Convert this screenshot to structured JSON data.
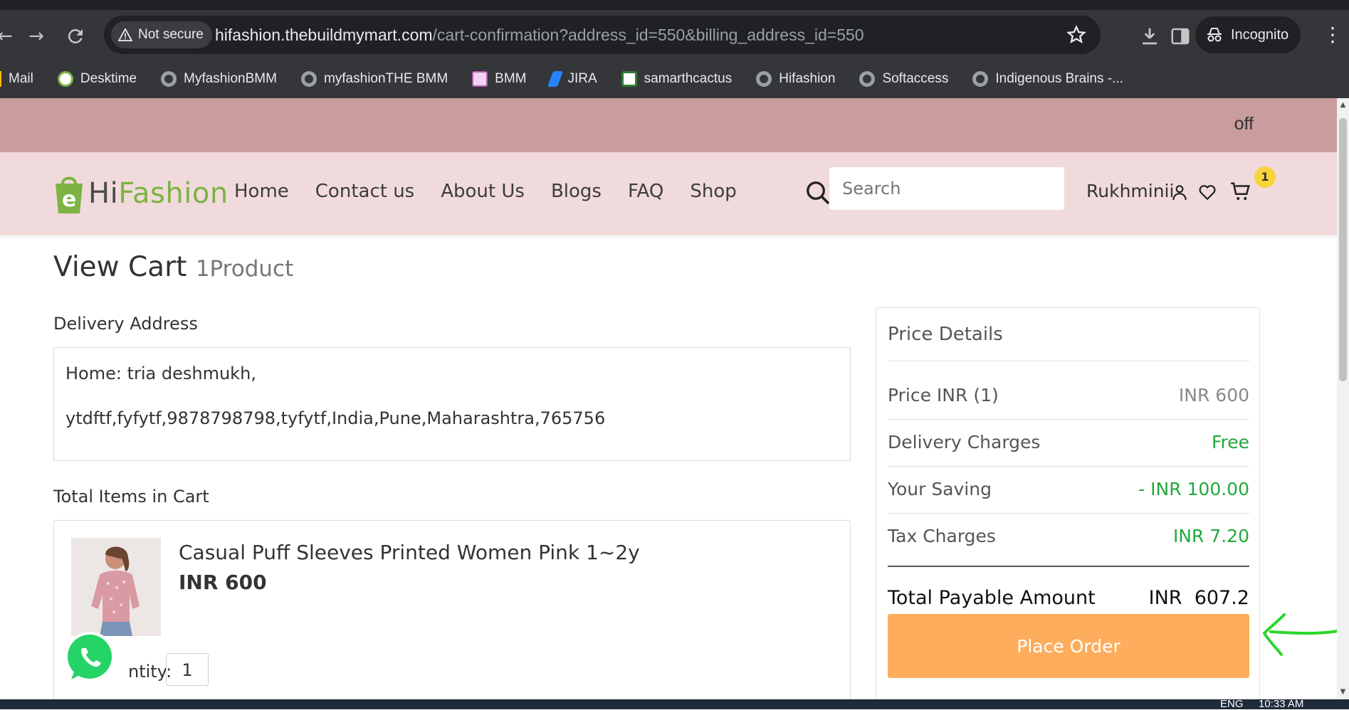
{
  "browser": {
    "security_label": "Not secure",
    "url_host": "hifashion.thebuildmymart.com",
    "url_path": "/cart-confirmation?address_id=550&billing_address_id=550",
    "profile_label": "Incognito",
    "bookmarks": [
      {
        "label": "Mail",
        "icon": "mail-icon"
      },
      {
        "label": "Desktime",
        "icon": "desktime-icon"
      },
      {
        "label": "MyfashionBMM",
        "icon": "globe-icon"
      },
      {
        "label": "myfashionTHE BMM",
        "icon": "globe-icon"
      },
      {
        "label": "BMM",
        "icon": "bmm-icon"
      },
      {
        "label": "JIRA",
        "icon": "jira-icon"
      },
      {
        "label": "samarthcactus",
        "icon": "samarth-icon"
      },
      {
        "label": "Hifashion",
        "icon": "globe-icon"
      },
      {
        "label": "Softaccess",
        "icon": "globe-icon"
      },
      {
        "label": "Indigenous Brains -...",
        "icon": "globe-icon"
      }
    ]
  },
  "site": {
    "promo_text": "off",
    "logo_hi": "Hi",
    "logo_fashion": "Fashion",
    "nav": [
      "Home",
      "Contact us",
      "About Us",
      "Blogs",
      "FAQ",
      "Shop"
    ],
    "search_placeholder": "Search",
    "user_name": "Rukhminii",
    "cart_count": "1",
    "brand_green": "#7cb342",
    "header_bg": "#f1dadb",
    "promo_bg": "#c99c9d"
  },
  "cart": {
    "title": "View Cart",
    "product_count": "1Product",
    "delivery_label": "Delivery Address",
    "address_line1": "Home: tria deshmukh,",
    "address_line2": "ytdftf,fyfytf,9878798798,tyfytf,India,Pune,Maharashtra,765756",
    "items_label": "Total Items in Cart",
    "items": [
      {
        "title": "Casual Puff Sleeves Printed Women Pink 1~2y",
        "price": "INR 600",
        "qty_label": "ntity:",
        "qty": "1"
      }
    ]
  },
  "price_details": {
    "title": "Price Details",
    "rows": [
      {
        "label": "Price INR (1)",
        "value": "INR 600"
      },
      {
        "label": "Delivery Charges",
        "value": "Free"
      },
      {
        "label": "Your Saving",
        "value": "- INR 100.00"
      },
      {
        "label": "Tax Charges",
        "value": "INR 7.20"
      }
    ],
    "total_label": "Total Payable Amount",
    "total_value": "INR  607.2",
    "place_order_label": "Place Order",
    "accent_green": "#22a83a",
    "button_color": "#fdad5b"
  },
  "taskbar": {
    "language": "ENG",
    "time": "10:33 AM"
  }
}
